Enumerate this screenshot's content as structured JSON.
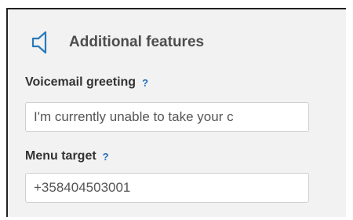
{
  "section": {
    "title": "Additional features",
    "icon": "speaker-icon"
  },
  "voicemail": {
    "label": "Voicemail greeting",
    "help": "?",
    "value": "I'm currently unable to take your c"
  },
  "menu_target": {
    "label": "Menu target",
    "help": "?",
    "value": "+358404503001"
  },
  "colors": {
    "accent": "#1f6fc0",
    "panel_bg": "#f2f2f2",
    "icon": "#2a7ab8"
  }
}
